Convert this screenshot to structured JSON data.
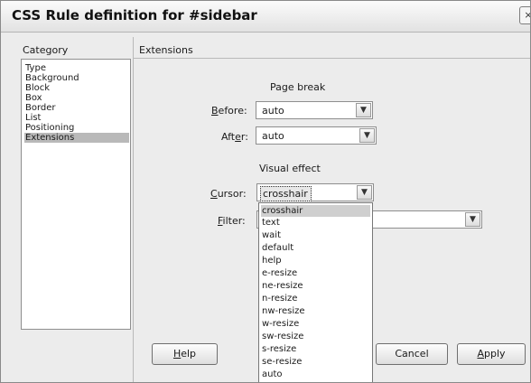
{
  "dialog": {
    "title": "CSS Rule definition for #sidebar",
    "close_icon": "close-icon"
  },
  "category": {
    "header": "Category",
    "items": [
      {
        "label": "Type"
      },
      {
        "label": "Background"
      },
      {
        "label": "Block"
      },
      {
        "label": "Box"
      },
      {
        "label": "Border"
      },
      {
        "label": "List"
      },
      {
        "label": "Positioning"
      },
      {
        "label": "Extensions",
        "selected": true
      }
    ]
  },
  "extensions": {
    "header": "Extensions",
    "page_break": {
      "title": "Page break",
      "before": {
        "accel": "B",
        "rest": "efore:",
        "value": "auto"
      },
      "after": {
        "pre": "Aft",
        "accel": "e",
        "post": "r:",
        "value": "auto"
      }
    },
    "visual_effect": {
      "title": "Visual effect",
      "cursor": {
        "accel": "C",
        "rest": "ursor:",
        "value": "crosshair"
      },
      "filter": {
        "accel": "F",
        "rest": "ilter:",
        "value": ""
      }
    },
    "cursor_options": [
      "crosshair",
      "text",
      "wait",
      "default",
      "help",
      "e-resize",
      "ne-resize",
      "n-resize",
      "nw-resize",
      "w-resize",
      "sw-resize",
      "s-resize",
      "se-resize",
      "auto"
    ]
  },
  "buttons": {
    "help": {
      "accel": "H",
      "rest": "elp"
    },
    "cancel": "Cancel",
    "apply": {
      "accel": "A",
      "rest": "pply"
    }
  },
  "colors": {
    "dialog_background": "#ececec",
    "selection": "#b9b9b9"
  }
}
